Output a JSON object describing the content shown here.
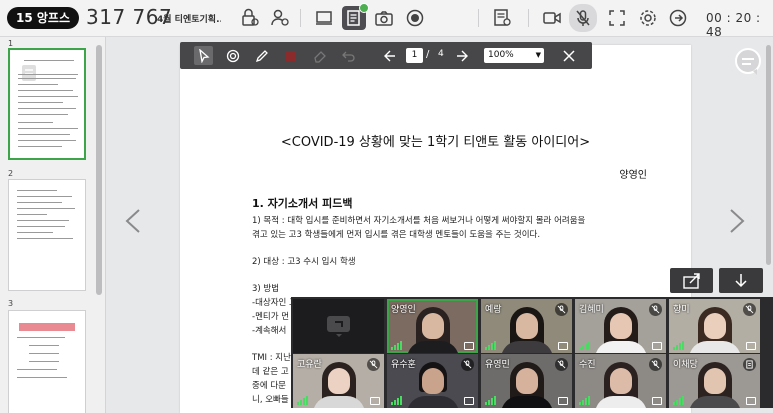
{
  "header": {
    "brand": "15 앙프스",
    "room_id": "317 767",
    "room_title": "4월 티엔토기획...",
    "timer": "00 : 20 : 48"
  },
  "icons": {
    "toolbar": [
      "lock-icon",
      "user-lock-icon",
      "screen-icon",
      "document-icon",
      "camera-icon",
      "record-icon",
      "participants-icon",
      "video-icon",
      "mic-muted-icon",
      "fullscreen-icon",
      "settings-icon",
      "exit-icon"
    ]
  },
  "thumbnails": {
    "items": [
      {
        "number": "1",
        "active": true
      },
      {
        "number": "2",
        "active": false
      },
      {
        "number": "3",
        "active": false
      }
    ]
  },
  "doc_toolbar": {
    "page_current": "1",
    "page_sep": "/",
    "page_total": "4",
    "zoom": "100%"
  },
  "document": {
    "title": "<COVID-19 상황에 맞는 1학기 티앤토 활동 아이디어>",
    "author": "양영인",
    "section1": "1. 자기소개서 피드백",
    "lines": [
      "1) 목적 : 대학 입시를 준비하면서 자기소개서를 처음 써보거나 어떻게 써야할지 몰라 어려움을",
      "겪고 있는 고3 학생들에게 먼저 입시를 겪은 대학생 멘토들이 도움을 주는 것이다.",
      "2) 대상 : 고3 수시 입시 학생",
      "3) 방법",
      "-대상자인 고3 학생과 대학생 멘토를 모집한다.(1:1 또는 1:2 매칭)",
      "-멘티가 먼",
      "-계속해서",
      "TMI : 지난",
      "데 같은 고",
      "중에 다문",
      "니, 오빠들"
    ]
  },
  "participants": [
    {
      "name": "",
      "type": "screen-share"
    },
    {
      "name": "양영인",
      "muted": false,
      "speaking": true
    },
    {
      "name": "예랑",
      "muted": true
    },
    {
      "name": "김혜미",
      "muted": true
    },
    {
      "name": "향미",
      "muted": true
    },
    {
      "name": "고유란",
      "muted": true
    },
    {
      "name": "유수훈",
      "muted": true
    },
    {
      "name": "유영민",
      "muted": true
    },
    {
      "name": "수진",
      "muted": true
    },
    {
      "name": "이채당",
      "muted": false
    }
  ],
  "colors": {
    "accent_green": "#3ea44a",
    "toolbar_dark": "#474749",
    "signal_green": "#4cd964"
  }
}
